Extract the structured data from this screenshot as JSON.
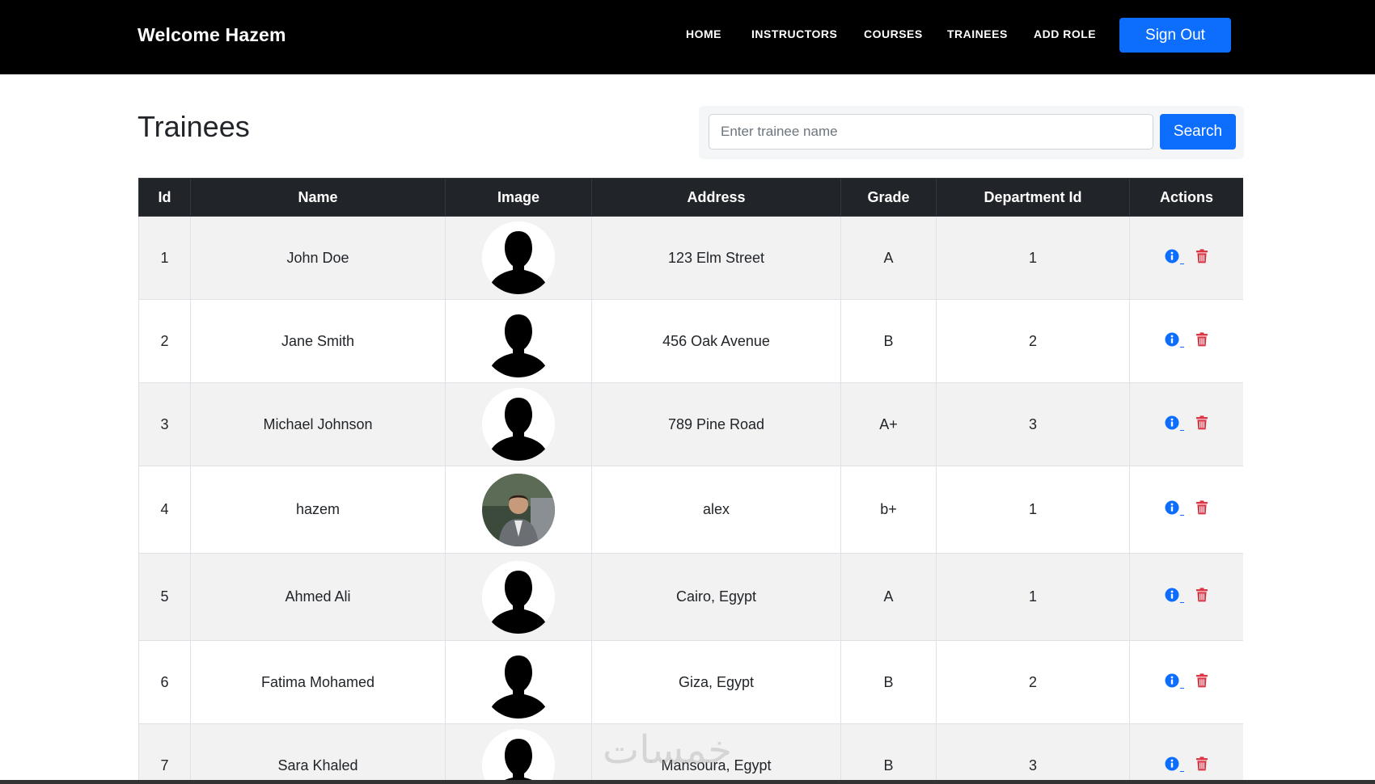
{
  "navbar": {
    "brand": "Welcome Hazem",
    "links": [
      {
        "label": "HOME"
      },
      {
        "label": "INSTRUCTORS"
      },
      {
        "label": "COURSES"
      },
      {
        "label": "TRAINEES"
      },
      {
        "label": "ADD ROLE"
      }
    ],
    "signout_label": "Sign Out"
  },
  "page": {
    "title": "Trainees"
  },
  "search": {
    "placeholder": "Enter trainee name",
    "value": "",
    "button_label": "Search"
  },
  "table": {
    "headers": [
      "Id",
      "Name",
      "Image",
      "Address",
      "Grade",
      "Department Id",
      "Actions"
    ],
    "rows": [
      {
        "id": "1",
        "name": "John Doe",
        "image": "silhouette",
        "address": "123 Elm Street",
        "grade": "A",
        "department_id": "1"
      },
      {
        "id": "2",
        "name": "Jane Smith",
        "image": "silhouette",
        "address": "456 Oak Avenue",
        "grade": "B",
        "department_id": "2"
      },
      {
        "id": "3",
        "name": "Michael Johnson",
        "image": "silhouette",
        "address": "789 Pine Road",
        "grade": "A+",
        "department_id": "3"
      },
      {
        "id": "4",
        "name": "hazem",
        "image": "photo",
        "address": "alex",
        "grade": "b+",
        "department_id": "1"
      },
      {
        "id": "5",
        "name": "Ahmed Ali",
        "image": "silhouette",
        "address": "Cairo, Egypt",
        "grade": "A",
        "department_id": "1"
      },
      {
        "id": "6",
        "name": "Fatima Mohamed",
        "image": "silhouette",
        "address": "Giza, Egypt",
        "grade": "B",
        "department_id": "2"
      },
      {
        "id": "7",
        "name": "Sara Khaled",
        "image": "silhouette",
        "address": "Mansoura, Egypt",
        "grade": "B",
        "department_id": "3"
      }
    ],
    "action_icons": [
      "info-circle-icon",
      "trash-icon"
    ]
  },
  "colors": {
    "navbar_bg": "#000000",
    "primary": "#0d6efd",
    "table_header_bg": "#212529",
    "danger": "#dc3545",
    "stripe": "#f2f2f2"
  },
  "watermark": "خمسات"
}
